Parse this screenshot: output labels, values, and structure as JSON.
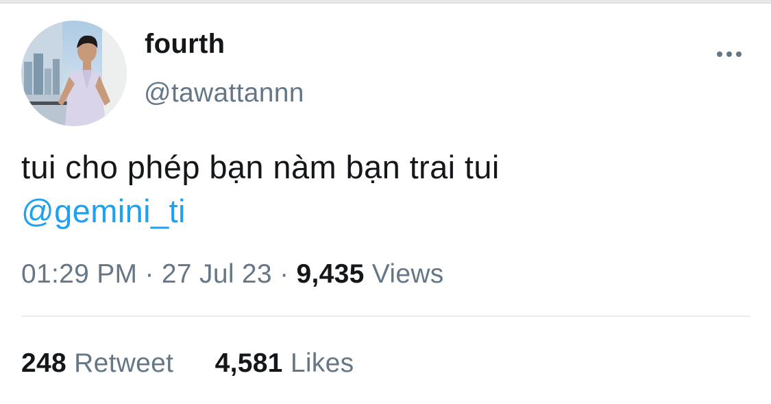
{
  "author": {
    "display_name": "fourth",
    "handle": "@tawattannn"
  },
  "tweet": {
    "text_line1": "tui cho phép bạn nàm bạn trai tui",
    "mention": "@gemini_ti"
  },
  "meta": {
    "time": "01:29 PM",
    "separator": "·",
    "date": "27 Jul 23",
    "views_count": "9,435",
    "views_label": "Views"
  },
  "stats": {
    "retweets_count": "248",
    "retweets_label": "Retweet",
    "likes_count": "4,581",
    "likes_label": "Likes"
  },
  "icons": {
    "more": "more-horizontal-icon"
  },
  "colors": {
    "text": "#14171a",
    "secondary": "#657786",
    "link": "#1da1f2",
    "divider": "#e6ecf0"
  }
}
